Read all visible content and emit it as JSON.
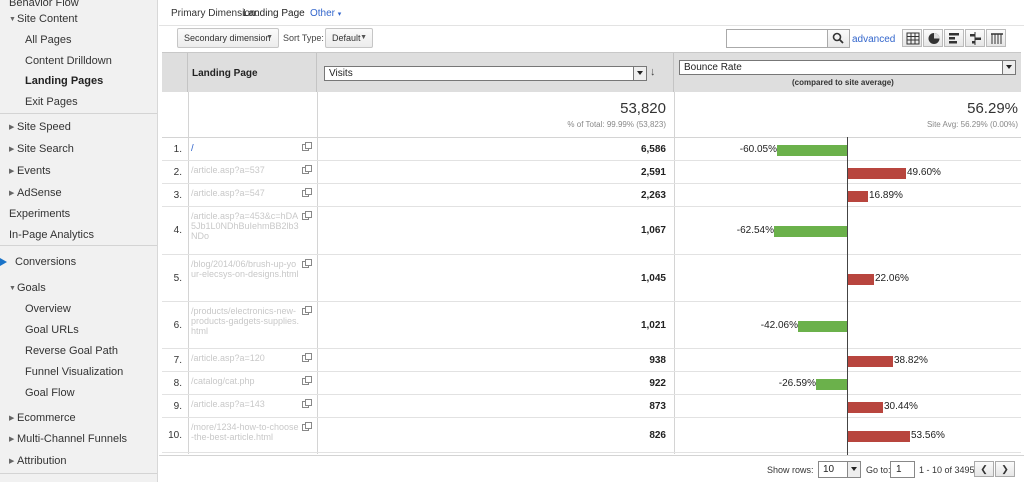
{
  "sidebar": {
    "items": [
      {
        "label": "Behavior Flow",
        "level": 1,
        "arrow": ""
      },
      {
        "label": "Site Content",
        "level": 1,
        "arrow": "open"
      },
      {
        "label": "All Pages",
        "level": 2,
        "arrow": ""
      },
      {
        "label": "Content Drilldown",
        "level": 2,
        "arrow": ""
      },
      {
        "label": "Landing Pages",
        "level": 2,
        "arrow": "",
        "active": true
      },
      {
        "label": "Exit Pages",
        "level": 2,
        "arrow": ""
      },
      {
        "label": "Site Speed",
        "level": 1,
        "arrow": "closed"
      },
      {
        "label": "Site Search",
        "level": 1,
        "arrow": "closed"
      },
      {
        "label": "Events",
        "level": 1,
        "arrow": "closed"
      },
      {
        "label": "AdSense",
        "level": 1,
        "arrow": "closed"
      },
      {
        "label": "Experiments",
        "level": 1,
        "arrow": ""
      },
      {
        "label": "In-Page Analytics",
        "level": 1,
        "arrow": ""
      },
      {
        "label": "Conversions",
        "level": 1,
        "arrow": "flag"
      },
      {
        "label": "Goals",
        "level": 1,
        "arrow": "open"
      },
      {
        "label": "Overview",
        "level": 2,
        "arrow": ""
      },
      {
        "label": "Goal URLs",
        "level": 2,
        "arrow": ""
      },
      {
        "label": "Reverse Goal Path",
        "level": 2,
        "arrow": ""
      },
      {
        "label": "Funnel Visualization",
        "level": 2,
        "arrow": ""
      },
      {
        "label": "Goal Flow",
        "level": 2,
        "arrow": ""
      },
      {
        "label": "Ecommerce",
        "level": 1,
        "arrow": "closed"
      },
      {
        "label": "Multi-Channel Funnels",
        "level": 1,
        "arrow": "closed"
      },
      {
        "label": "Attribution",
        "level": 1,
        "arrow": "closed"
      }
    ],
    "accent_color": "#1a73c8"
  },
  "primary_dimension": {
    "label": "Primary Dimension:",
    "value": "Landing Page",
    "other": "Other"
  },
  "toolbar": {
    "secondary_dimension": "Secondary dimension",
    "sort_type_label": "Sort Type:",
    "sort_type_value": "Default",
    "search_placeholder": "",
    "advanced": "advanced",
    "view_icons": [
      "table-view-icon",
      "pie-view-icon",
      "performance-view-icon",
      "comparison-view-icon",
      "pivot-view-icon"
    ]
  },
  "table": {
    "col_landing": "Landing Page",
    "col_metric1": "Visits",
    "col_metric2": "Bounce Rate",
    "col_metric2_sub": "(compared to site average)",
    "totals": {
      "visits": "53,820",
      "visits_sub": "% of Total: 99.99% (53,823)",
      "bounce": "56.29%",
      "bounce_sub": "Site Avg: 56.29% (0.00%)"
    },
    "rows": [
      {
        "num": "1.",
        "page": "/",
        "link": true,
        "visits": "6,586",
        "delta": -60.05,
        "label": "-60.05%"
      },
      {
        "num": "2.",
        "page": "/article.asp?a=537",
        "link": false,
        "visits": "2,591",
        "delta": 49.6,
        "label": "49.60%"
      },
      {
        "num": "3.",
        "page": "/article.asp?a=547",
        "link": false,
        "visits": "2,263",
        "delta": 16.89,
        "label": "16.89%"
      },
      {
        "num": "4.",
        "page": "/article.asp?a=453&c=hDA5Jb1L0NDhBuIehmBB2lb3NDo",
        "link": false,
        "visits": "1,067",
        "delta": -62.54,
        "label": "-62.54%"
      },
      {
        "num": "5.",
        "page": "/blog/2014/06/brush-up-your-elecsys-on-designs.html",
        "link": false,
        "visits": "1,045",
        "delta": 22.06,
        "label": "22.06%"
      },
      {
        "num": "6.",
        "page": "/products/electronics-new-products-gadgets-supplies.html",
        "link": false,
        "visits": "1,021",
        "delta": -42.06,
        "label": "-42.06%"
      },
      {
        "num": "7.",
        "page": "/article.asp?a=120",
        "link": false,
        "visits": "938",
        "delta": 38.82,
        "label": "38.82%"
      },
      {
        "num": "8.",
        "page": "/catalog/cat.php",
        "link": false,
        "visits": "922",
        "delta": -26.59,
        "label": "-26.59%"
      },
      {
        "num": "9.",
        "page": "/article.asp?a=143",
        "link": false,
        "visits": "873",
        "delta": 30.44,
        "label": "30.44%"
      },
      {
        "num": "10.",
        "page": "/more/1234-how-to-choose-the-best-article.html",
        "link": false,
        "visits": "826",
        "delta": 53.56,
        "label": "53.56%"
      }
    ],
    "colors": {
      "negative": "#6bb14b",
      "positive": "#b8453e"
    }
  },
  "pager": {
    "show_rows_label": "Show rows:",
    "show_rows_value": "10",
    "goto_label": "Go to:",
    "goto_value": "1",
    "range": "1 - 10 of 3495"
  }
}
